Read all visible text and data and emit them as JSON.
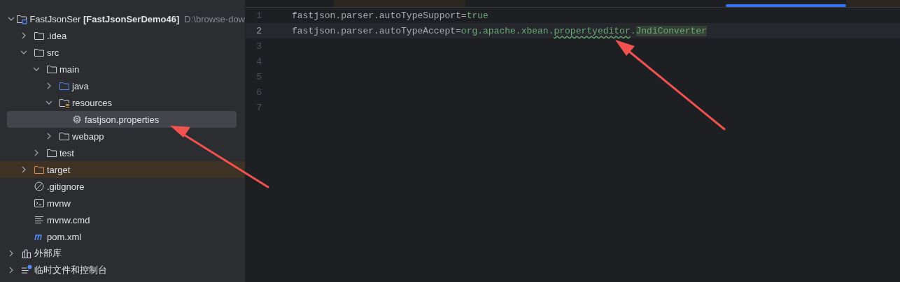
{
  "project_tree": [
    {
      "label": "FastJsonSer **[FastJsonSerDemo46]**",
      "path": "D:\\browse-dow",
      "kind": "project",
      "expanded": true,
      "selected": false,
      "children": [
        {
          "label": ".idea",
          "kind": "folder",
          "expanded": false,
          "selected": false
        },
        {
          "label": "src",
          "kind": "folder",
          "expanded": true,
          "selected": false,
          "children": [
            {
              "label": "main",
              "kind": "folder",
              "expanded": true,
              "selected": false,
              "children": [
                {
                  "label": "java",
                  "kind": "source-folder",
                  "expanded": false,
                  "selected": false
                },
                {
                  "label": "resources",
                  "kind": "resource-folder",
                  "expanded": true,
                  "selected": false,
                  "children": [
                    {
                      "label": "fastjson.properties",
                      "kind": "properties-file",
                      "selected": true
                    }
                  ]
                },
                {
                  "label": "webapp",
                  "kind": "folder",
                  "expanded": false,
                  "selected": false
                }
              ]
            },
            {
              "label": "test",
              "kind": "folder",
              "expanded": false,
              "selected": false
            }
          ]
        },
        {
          "label": "target",
          "kind": "excluded-folder",
          "expanded": false,
          "selected": false
        },
        {
          "label": ".gitignore",
          "kind": "ignore-file",
          "selected": false
        },
        {
          "label": "mvnw",
          "kind": "script-file",
          "selected": false
        },
        {
          "label": "mvnw.cmd",
          "kind": "text-file",
          "selected": false
        },
        {
          "label": "pom.xml",
          "kind": "maven-file",
          "selected": false
        }
      ]
    },
    {
      "label": "外部库",
      "kind": "libraries",
      "expanded": false,
      "selected": false
    },
    {
      "label": "临时文件和控制台",
      "kind": "scratches",
      "expanded": false,
      "selected": false
    }
  ],
  "editor": {
    "lines": [
      {
        "number": "1",
        "current": false,
        "segments": [
          {
            "text": "fastjson.parser.autoTypeSupport=",
            "kind": "key"
          },
          {
            "text": "true",
            "kind": "value"
          }
        ]
      },
      {
        "number": "2",
        "current": true,
        "segments": [
          {
            "text": "fastjson.parser.autoTypeAccept=",
            "kind": "key"
          },
          {
            "text": "org.apache.xbean.",
            "kind": "value"
          },
          {
            "text": "propertyeditor",
            "kind": "typo"
          },
          {
            "text": ".",
            "kind": "value"
          },
          {
            "text": "JndiConverter",
            "kind": "match"
          }
        ]
      },
      {
        "number": "3",
        "current": false
      },
      {
        "number": "4",
        "current": false
      },
      {
        "number": "5",
        "current": false
      },
      {
        "number": "6",
        "current": false
      },
      {
        "number": "7",
        "current": false
      }
    ]
  }
}
